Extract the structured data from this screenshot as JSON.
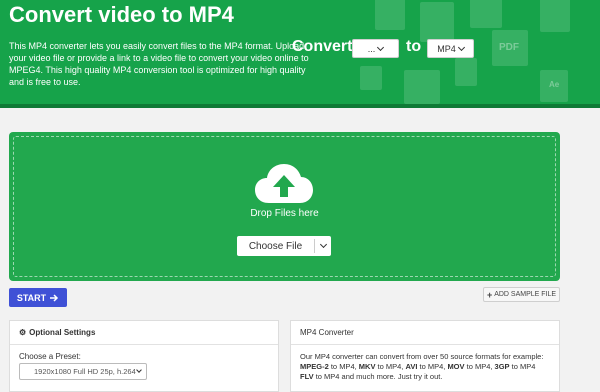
{
  "hero": {
    "title": "Convert video to MP4",
    "description": "This MP4 converter lets you easily convert files to the MP4 format. Upload your video file or provide a link to a video file to convert your video online to MPEG4. This high quality MP4 conversion tool is optimized for high quality and is free to use.",
    "convert_label": "Convert",
    "from_value": "...",
    "to_label": "to",
    "to_value": "MP4",
    "deco_labels": [
      "PDF",
      "Ae"
    ]
  },
  "dropzone": {
    "drop_text": "Drop Files here",
    "choose_label": "Choose File"
  },
  "actions": {
    "start_label": "START",
    "sample_label": "ADD SAMPLE FILE"
  },
  "optional_settings": {
    "title": "Optional Settings",
    "preset_label": "Choose a Preset:",
    "preset_value": "1920x1080 Full HD 25p, h.264"
  },
  "info": {
    "title": "MP4 Converter",
    "intro": "Our MP4 converter can convert from over 50 source formats for example: ",
    "f1": "MPEG-2",
    "f2": "MKV",
    "f3": "AVI",
    "f4": "MOV",
    "f5": "3GP",
    "f6": "FLV",
    "to_word": " to MP4, ",
    "to_word_last": " to MP4 ",
    "closing": "to MP4 and much more. Just try it out."
  },
  "colors": {
    "hero_green": "#16a34a",
    "drop_green": "#22a84e",
    "start_blue": "#3f51d6"
  }
}
